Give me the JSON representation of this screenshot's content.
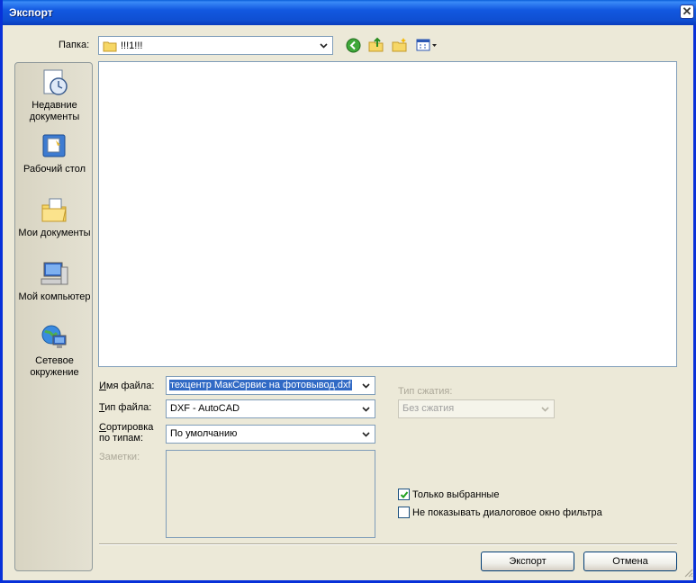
{
  "window": {
    "title": "Экспорт"
  },
  "toolbar": {
    "folder_label": "Папка:",
    "folder_value": "!!!1!!!"
  },
  "places": [
    {
      "label_line1": "Недавние",
      "label_line2": "документы",
      "icon": "recent-documents-icon"
    },
    {
      "label_line1": "Рабочий стол",
      "label_line2": "",
      "icon": "desktop-icon"
    },
    {
      "label_line1": "Мои документы",
      "label_line2": "",
      "icon": "my-documents-icon"
    },
    {
      "label_line1": "Мой компьютер",
      "label_line2": "",
      "icon": "my-computer-icon"
    },
    {
      "label_line1": "Сетевое",
      "label_line2": "окружение",
      "icon": "network-icon"
    }
  ],
  "form": {
    "filename_label": "Имя файла:",
    "filename_value": "техцентр МакСервис на фотовывод.dxf",
    "filetype_label": "Тип файла:",
    "filetype_value": "DXF - AutoCAD",
    "sort_label_line1": "Сортировка",
    "sort_label_line2": "по типам:",
    "sort_value": "По умолчанию",
    "notes_label": "Заметки:",
    "compression_label": "Тип сжатия:",
    "compression_value": "Без сжатия"
  },
  "options": {
    "only_selected_label": "Только выбранные",
    "only_selected_checked": true,
    "no_filter_dialog_label": "Не показывать диалоговое окно фильтра",
    "no_filter_dialog_checked": false
  },
  "buttons": {
    "export_label": "Экспорт",
    "cancel_label": "Отмена"
  }
}
